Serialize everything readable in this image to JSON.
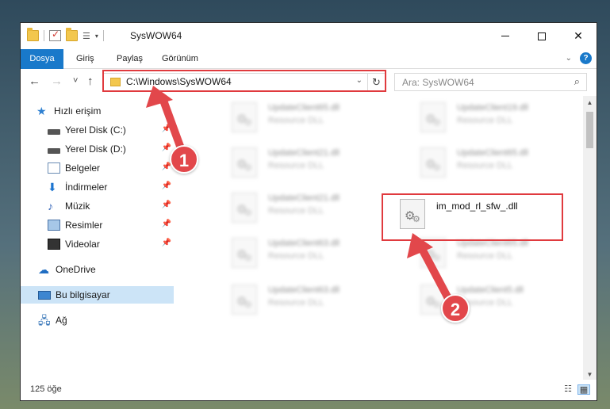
{
  "window": {
    "title": "SysWOW64",
    "minimize_icon": "minimize-icon",
    "maximize_icon": "maximize-icon",
    "close_symbol": "✕"
  },
  "ribbon": {
    "tabs": [
      "Dosya",
      "Giriş",
      "Paylaş",
      "Görünüm"
    ],
    "help_label": "?"
  },
  "navigation": {
    "back": "←",
    "forward": "→",
    "recent": "˅",
    "up": "↑",
    "address": "C:\\Windows\\SysWOW64",
    "refresh": "↻",
    "search_placeholder": "Ara: SysWOW64"
  },
  "sidebar": {
    "items": [
      {
        "label": "Hızlı erişim",
        "icon": "star-icon"
      },
      {
        "label": "Yerel Disk (C:)",
        "icon": "drive-icon",
        "pinned": true
      },
      {
        "label": "Yerel Disk (D:)",
        "icon": "drive-icon",
        "pinned": true
      },
      {
        "label": "Belgeler",
        "icon": "documents-icon",
        "pinned": true
      },
      {
        "label": "İndirmeler",
        "icon": "download-icon",
        "pinned": true
      },
      {
        "label": "Müzik",
        "icon": "music-icon",
        "pinned": true
      },
      {
        "label": "Resimler",
        "icon": "pictures-icon",
        "pinned": true
      },
      {
        "label": "Videolar",
        "icon": "videos-icon",
        "pinned": true
      },
      {
        "label": "OneDrive",
        "icon": "onedrive-icon"
      },
      {
        "label": "Bu bilgisayar",
        "icon": "this-pc-icon",
        "selected": true
      },
      {
        "label": "Ağ",
        "icon": "network-icon"
      }
    ]
  },
  "files": [
    {
      "name": "UpdateClient65.dll",
      "desc": "Resource DLL",
      "blurred": true
    },
    {
      "name": "UpdateClient19.dll",
      "desc": "Resource DLL",
      "blurred": true
    },
    {
      "name": "UpdateClient21.dll",
      "desc": "Resource DLL",
      "blurred": true
    },
    {
      "name": "UpdateClient65.dll",
      "desc": "Resource DLL",
      "blurred": true
    },
    {
      "name": "UpdateClient21.dll",
      "desc": "Resource DLL",
      "blurred": true
    },
    {
      "name": "im_mod_rl_sfw_.dll",
      "desc": "",
      "blurred": false
    },
    {
      "name": "UpdateClient63.dll",
      "desc": "Resource DLL",
      "blurred": true
    },
    {
      "name": "UpdateClient65.dll",
      "desc": "Resource DLL",
      "blurred": true
    },
    {
      "name": "UpdateClient63.dll",
      "desc": "Resource DLL",
      "blurred": true
    },
    {
      "name": "UpdateClient5.dll",
      "desc": "Resource DLL",
      "blurred": true
    }
  ],
  "status": {
    "item_count": "125 öğe"
  },
  "annotations": {
    "badge1": "1",
    "badge2": "2",
    "color": "#e2474b"
  }
}
